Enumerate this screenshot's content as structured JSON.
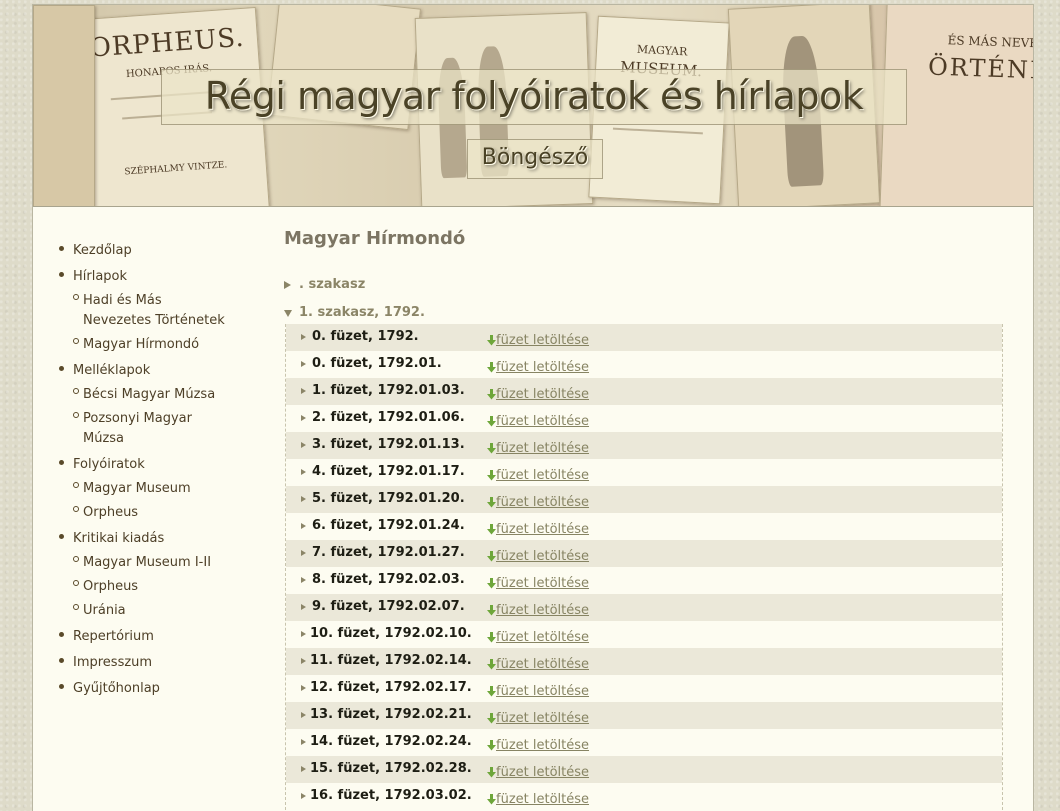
{
  "header": {
    "title": "Régi magyar folyóiratok és hírlapok",
    "subtitle": "Böngésző",
    "paper_texts": {
      "orpheus": "ORPHEUS.",
      "orpheus_sub": "HONAPOS IRÁS.",
      "orpheus_author": "SZÉPHALMY VINTZE.",
      "museum1": "MAGYAR",
      "museum2": "MUSEUM.",
      "hadi1": "ÉS MÁS NEVEZ",
      "hadi2": "ÖRTÉNE"
    }
  },
  "sidebar": {
    "groups": [
      {
        "label": "Kezdőlap",
        "items": []
      },
      {
        "label": "Hírlapok",
        "items": [
          "Hadi és Más Nevezetes Történetek",
          "Magyar Hírmondó"
        ]
      },
      {
        "label": "Melléklapok",
        "items": [
          "Bécsi Magyar Múzsa",
          "Pozsonyi Magyar Múzsa"
        ]
      },
      {
        "label": "Folyóiratok",
        "items": [
          "Magyar Museum",
          "Orpheus"
        ]
      },
      {
        "label": "Kritikai kiadás",
        "items": [
          "Magyar Museum I-II",
          "Orpheus",
          "Uránia"
        ]
      },
      {
        "label": "Repertórium",
        "items": []
      },
      {
        "label": "Impresszum",
        "items": []
      },
      {
        "label": "Gyűjtőhonlap",
        "items": []
      }
    ]
  },
  "main": {
    "title": "Magyar Hírmondó",
    "sections": [
      {
        "label": ". szakasz",
        "expanded": false
      },
      {
        "label": "1. szakasz, 1792.",
        "expanded": true
      }
    ],
    "download_label": "füzet letöltése",
    "issues": [
      "0. füzet, 1792.",
      "0. füzet, 1792.01.",
      "1. füzet, 1792.01.03.",
      "2. füzet, 1792.01.06.",
      "3. füzet, 1792.01.13.",
      "4. füzet, 1792.01.17.",
      "5. füzet, 1792.01.20.",
      "6. füzet, 1792.01.24.",
      "7. füzet, 1792.01.27.",
      "8. füzet, 1792.02.03.",
      "9. füzet, 1792.02.07.",
      "10. füzet, 1792.02.10.",
      "11. füzet, 1792.02.14.",
      "12. füzet, 1792.02.17.",
      "13. füzet, 1792.02.21.",
      "14. füzet, 1792.02.24.",
      "15. füzet, 1792.02.28.",
      "16. füzet, 1792.03.02."
    ]
  },
  "colors": {
    "page_background": "#dedbc9",
    "content_background": "#fdfcf1",
    "row_alternate": "#ebe8d9",
    "download_icon": "#6ea63a",
    "link": "#878463"
  }
}
